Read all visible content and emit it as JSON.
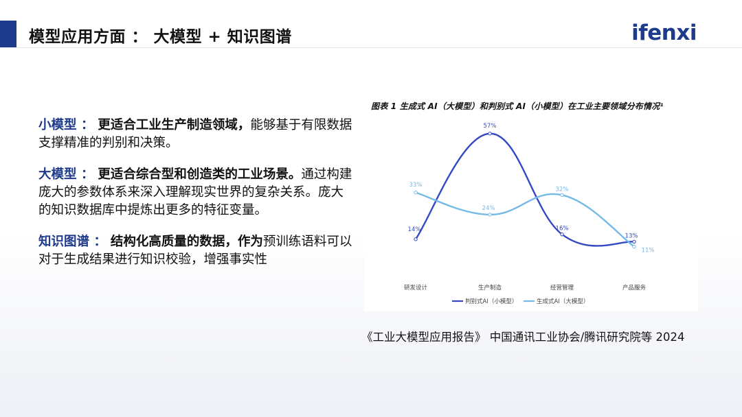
{
  "header": {
    "title": "模型应用方面 ： 大模型 + 知识图谱",
    "logo": "ifenxi"
  },
  "points": [
    {
      "keyword": "小模型 ：",
      "bold": "更适合工业生产制造领域，",
      "rest": "能够基于有限数据支撑精准的判别和决策。"
    },
    {
      "keyword": "大模型 ：",
      "bold": "更适合综合型和创造类的工业场景。",
      "rest": "通过构建庞大的参数体系来深入理解现实世界的复杂关系。庞大的知识数据库中提炼出更多的特征变量。"
    },
    {
      "keyword": "知识图谱 ：",
      "bold": "结构化高质量的数据，作为",
      "rest": "预训练语料可以对于生成结果进行知识校验，增强事实性"
    }
  ],
  "figure_caption": "图表 1 生成式 AI（大模型）和判别式 AI（小模型）在工业主要领域分布情况¹",
  "source": "《工业大模型应用报告》 中国通讯工业协会/腾讯研究院等 2024",
  "chart_data": {
    "type": "line",
    "categories": [
      "研发设计",
      "生产制造",
      "经营管理",
      "产品服务"
    ],
    "series": [
      {
        "name": "判别式AI（小模型）",
        "values": [
          14,
          57,
          16,
          13
        ],
        "labels": [
          "14%",
          "57%",
          "16%",
          "13%"
        ],
        "color": "#3448c5"
      },
      {
        "name": "生成式AI（大模型）",
        "values": [
          33,
          24,
          32,
          11
        ],
        "labels": [
          "33%",
          "24%",
          "32%",
          "11%"
        ],
        "color": "#74b9e8"
      }
    ],
    "ylim": [
      0,
      60
    ],
    "smooth": true,
    "grid": false,
    "legend": "bottom"
  }
}
